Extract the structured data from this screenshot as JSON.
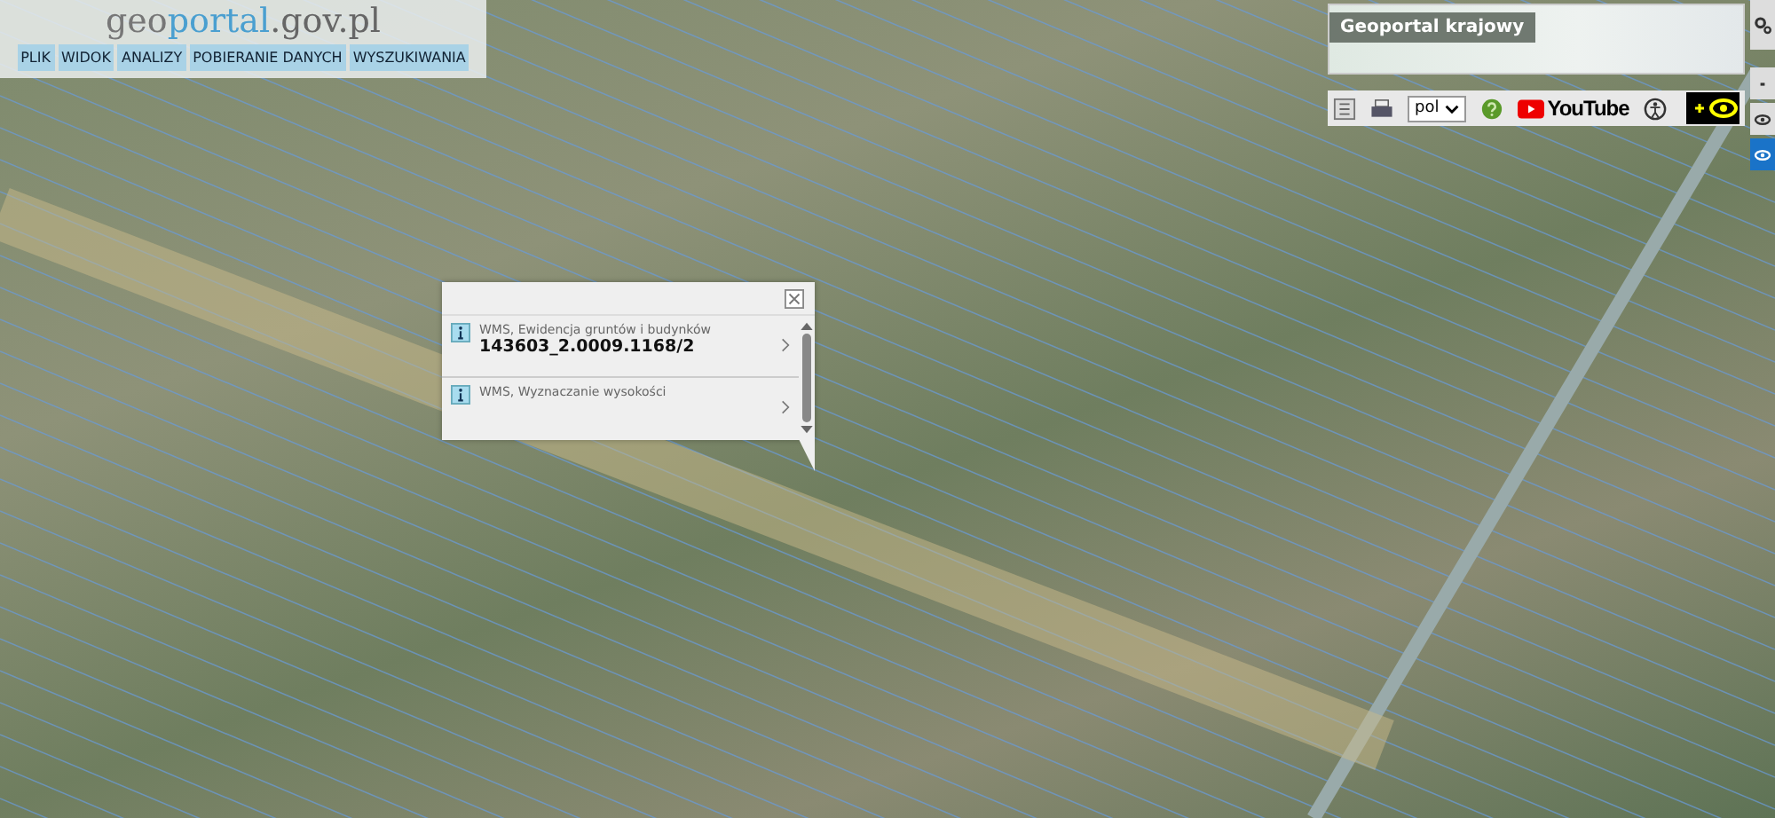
{
  "logo": {
    "parts": [
      "geo",
      "portal",
      ".gov.pl"
    ]
  },
  "menu": [
    "PLIK",
    "WIDOK",
    "ANALIZY",
    "POBIERANIE DANYCH",
    "WYSZUKIWANIA"
  ],
  "overview_map": {
    "title": "Geoportal krajowy"
  },
  "toolbar": {
    "language": "pol",
    "youtube": "YouTube"
  },
  "popup": {
    "items": [
      {
        "layer": "WMS, Ewidencja gruntów i budynków",
        "value": "143603_2.0009.1168/2"
      },
      {
        "layer": "WMS, Wyznaczanie wysokości"
      }
    ]
  },
  "side_buttons": [
    {
      "kind": "settings",
      "selected": false
    },
    {
      "kind": "dot",
      "selected": false
    },
    {
      "kind": "eye",
      "selected": false
    },
    {
      "kind": "eye",
      "selected": true
    }
  ]
}
